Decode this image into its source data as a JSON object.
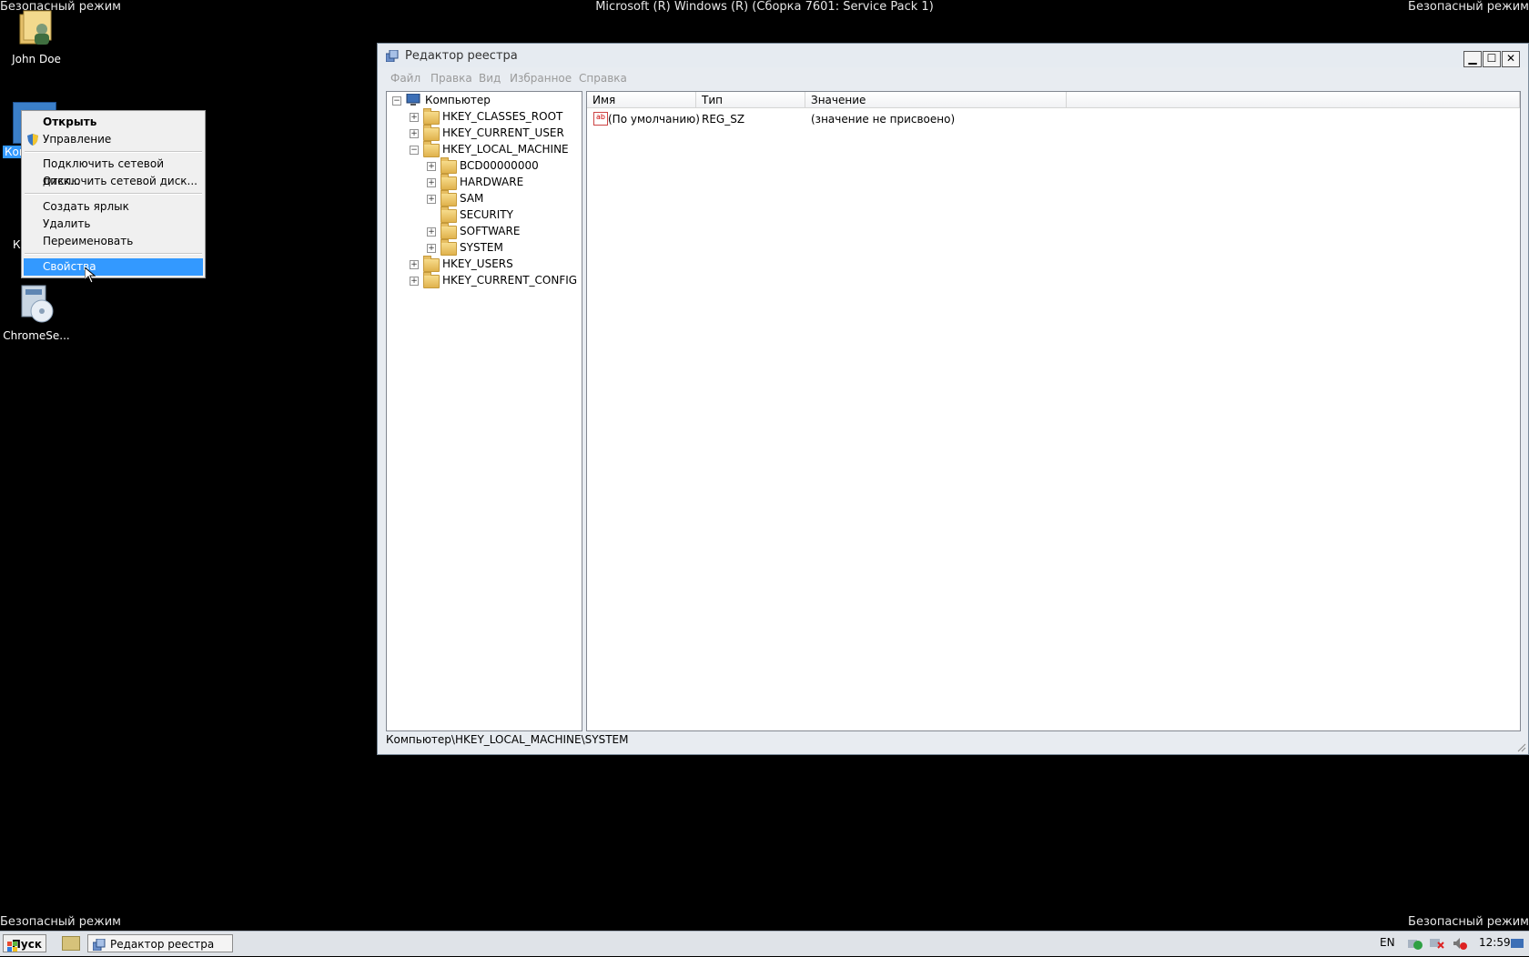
{
  "desktop": {
    "safe_mode": "Безопасный режим",
    "os_build": "Microsoft (R) Windows (R) (Сборка 7601: Service Pack 1)",
    "icons": [
      {
        "label": "John Doe"
      },
      {
        "label": "Ком"
      },
      {
        "label": "К"
      },
      {
        "label": "ChromeSe..."
      }
    ]
  },
  "context_menu": {
    "items": [
      {
        "label": "Открыть"
      },
      {
        "label": "Управление"
      },
      {
        "label": "Подключить сетевой диск..."
      },
      {
        "label": "Отключить сетевой диск..."
      },
      {
        "label": "Создать ярлык"
      },
      {
        "label": "Удалить"
      },
      {
        "label": "Переименовать"
      },
      {
        "label": "Свойства"
      }
    ]
  },
  "regedit": {
    "title": "Редактор реестра",
    "menu": [
      "Файл",
      "Правка",
      "Вид",
      "Избранное",
      "Справка"
    ],
    "tree": [
      {
        "label": "Компьютер"
      },
      {
        "label": "HKEY_CLASSES_ROOT"
      },
      {
        "label": "HKEY_CURRENT_USER"
      },
      {
        "label": "HKEY_LOCAL_MACHINE"
      },
      {
        "label": "BCD00000000"
      },
      {
        "label": "HARDWARE"
      },
      {
        "label": "SAM"
      },
      {
        "label": "SECURITY"
      },
      {
        "label": "SOFTWARE"
      },
      {
        "label": "SYSTEM"
      },
      {
        "label": "HKEY_USERS"
      },
      {
        "label": "HKEY_CURRENT_CONFIG"
      }
    ],
    "columns": [
      "Имя",
      "Тип",
      "Значение"
    ],
    "rows": [
      {
        "name": "(По умолчанию)",
        "type": "REG_SZ",
        "value": "(значение не присвоено)"
      }
    ],
    "status_path": "Компьютер\\HKEY_LOCAL_MACHINE\\SYSTEM"
  },
  "taskbar": {
    "start_label": "Пуск",
    "tasks": [
      {
        "label": "Редактор реестра"
      }
    ],
    "language": "EN",
    "clock": "12:59"
  }
}
